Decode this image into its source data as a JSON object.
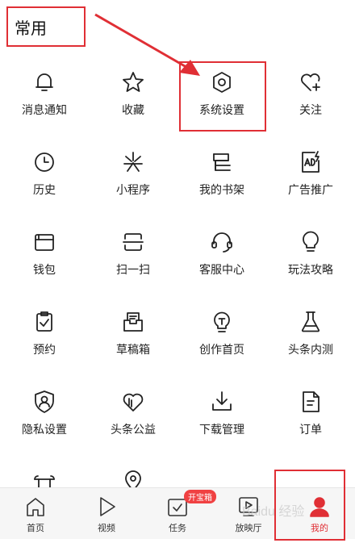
{
  "section": {
    "title": "常用"
  },
  "grid": [
    {
      "label": "消息通知",
      "icon": "bell-icon"
    },
    {
      "label": "收藏",
      "icon": "star-icon"
    },
    {
      "label": "系统设置",
      "icon": "gear-icon"
    },
    {
      "label": "关注",
      "icon": "heart-plus-icon"
    },
    {
      "label": "历史",
      "icon": "clock-icon"
    },
    {
      "label": "小程序",
      "icon": "mini-program-icon"
    },
    {
      "label": "我的书架",
      "icon": "bookshelf-icon"
    },
    {
      "label": "广告推广",
      "icon": "ad-icon"
    },
    {
      "label": "钱包",
      "icon": "wallet-icon"
    },
    {
      "label": "扫一扫",
      "icon": "scan-icon"
    },
    {
      "label": "客服中心",
      "icon": "headset-icon"
    },
    {
      "label": "玩法攻略",
      "icon": "lightbulb-icon"
    },
    {
      "label": "预约",
      "icon": "clipboard-check-icon"
    },
    {
      "label": "草稿箱",
      "icon": "drafts-icon"
    },
    {
      "label": "创作首页",
      "icon": "bulb-t-icon"
    },
    {
      "label": "头条内测",
      "icon": "flask-icon"
    },
    {
      "label": "隐私设置",
      "icon": "shield-user-icon"
    },
    {
      "label": "头条公益",
      "icon": "charity-icon"
    },
    {
      "label": "下载管理",
      "icon": "download-icon"
    },
    {
      "label": "订单",
      "icon": "document-icon"
    }
  ],
  "tabbar": [
    {
      "label": "首页",
      "icon": "home-icon"
    },
    {
      "label": "视频",
      "icon": "play-icon"
    },
    {
      "label": "任务",
      "icon": "task-icon",
      "badge": "开宝箱"
    },
    {
      "label": "放映厅",
      "icon": "theater-icon"
    },
    {
      "label": "我的",
      "icon": "profile-icon",
      "active": true
    }
  ],
  "watermark": "Baidu 经验",
  "colors": {
    "highlight": "#e02f35",
    "badge": "#f04142",
    "tabbar_bg": "#f6f6f6"
  }
}
